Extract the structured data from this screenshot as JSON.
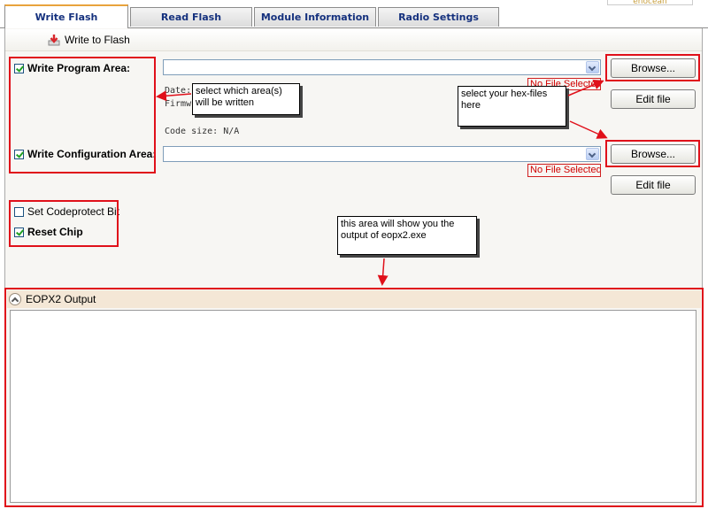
{
  "tabs": [
    {
      "label": "Write Flash",
      "active": true
    },
    {
      "label": "Read Flash",
      "active": false
    },
    {
      "label": "Module Information",
      "active": false
    },
    {
      "label": "Radio Settings",
      "active": false
    }
  ],
  "logo_text": "enocean",
  "toolbar": {
    "write_label": "Write to Flash",
    "icon": "write-flash-icon"
  },
  "program_area": {
    "label": "Write Program Area:",
    "checked": true,
    "file_status": "No File Selected",
    "browse_label": "Browse...",
    "edit_label": "Edit file",
    "info_date_label": "Date:",
    "info_firmware_label": "Firmw",
    "code_size": "Code size:  N/A"
  },
  "config_area": {
    "label": "Write Configuration Area:",
    "checked": true,
    "file_status": "No File Selected",
    "browse_label": "Browse...",
    "edit_label": "Edit file"
  },
  "options": {
    "codeprotect_label": "Set Codeprotect Bit",
    "codeprotect_checked": false,
    "reset_label": "Reset Chip",
    "reset_checked": true
  },
  "callouts": {
    "select_area": "select which area(s) will be written",
    "select_hex": "select your hex-files here",
    "output_note": "this area will show you the output of eopx2.exe"
  },
  "output": {
    "title": "EOPX2 Output",
    "content": ""
  },
  "colors": {
    "annotation_red": "#e0101a",
    "tab_accent": "#e8a33c",
    "output_header": "#f4e7d6",
    "error_text": "#d00000"
  }
}
